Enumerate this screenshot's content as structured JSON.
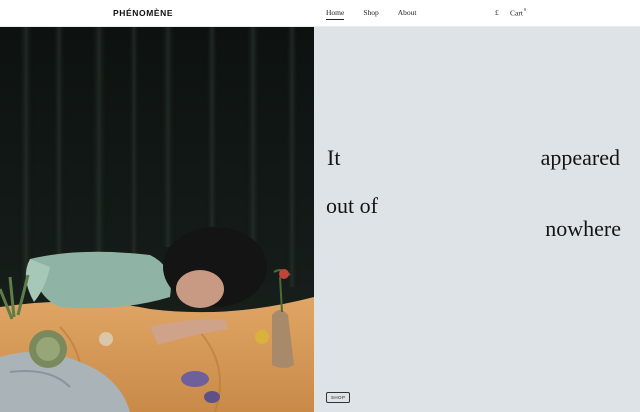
{
  "header": {
    "logo": "PHÉNOMÈNE",
    "nav": [
      {
        "label": "Home",
        "active": true
      },
      {
        "label": "Shop",
        "active": false
      },
      {
        "label": "About",
        "active": false
      }
    ],
    "currency": "£",
    "cart_label": "Cart",
    "cart_count": "0"
  },
  "hero": {
    "headline_words": [
      "It",
      "appeared",
      "out of",
      "nowhere"
    ],
    "shop_button": "SHOP",
    "panel_color": "#dde3e6",
    "image_description_icon": "photo-woman-lying-on-fabric"
  }
}
